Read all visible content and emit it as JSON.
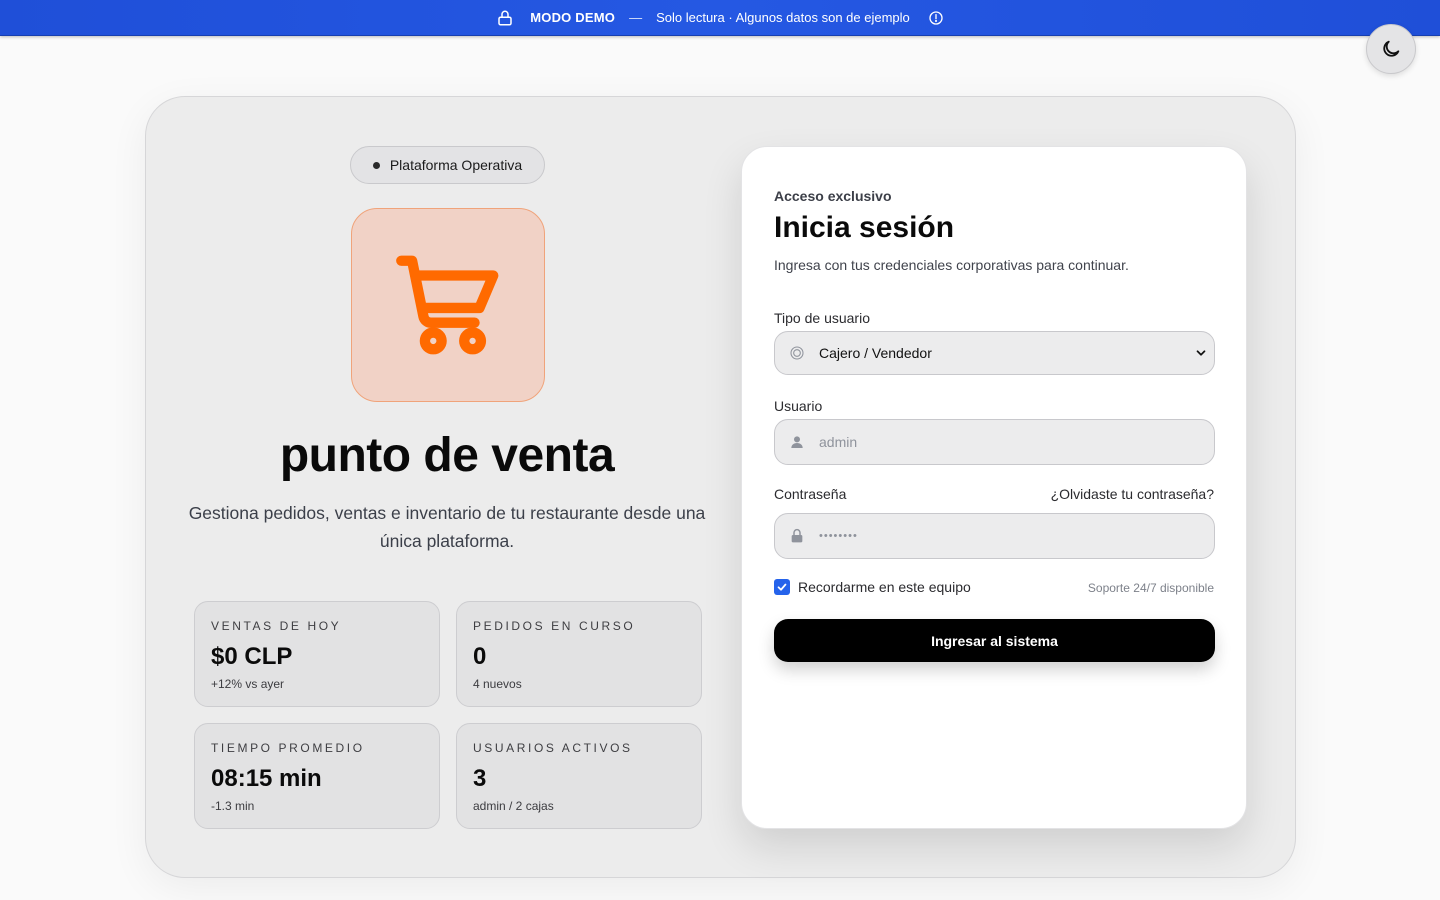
{
  "banner": {
    "mode": "MODO DEMO",
    "separator": "—",
    "message": "Solo lectura · Algunos datos son de ejemplo",
    "lock_icon": "lock-icon",
    "info_icon": "info-icon"
  },
  "theme_toggle": {
    "icon": "moon-icon"
  },
  "brand": {
    "pill": "Plataforma Operativa",
    "icon": "shopping-cart-icon",
    "title": "punto de venta",
    "subtitle": "Gestiona pedidos, ventas e inventario de tu restaurante desde una única plataforma."
  },
  "stats": [
    {
      "label": "Ventas de hoy",
      "value": "$0 CLP",
      "note": "+12% vs ayer"
    },
    {
      "label": "Pedidos en curso",
      "value": "0",
      "note": "4 nuevos"
    },
    {
      "label": "Tiempo promedio",
      "value": "08:15 min",
      "note": "-1.3 min"
    },
    {
      "label": "Usuarios activos",
      "value": "3",
      "note": "admin / 2 cajas"
    }
  ],
  "login": {
    "eyebrow": "Acceso exclusivo",
    "heading": "Inicia sesión",
    "description": "Ingresa con tus credenciales corporativas para continuar.",
    "user_type_label": "Tipo de usuario",
    "user_type_value": "Cajero / Vendedor",
    "username_label": "Usuario",
    "username_placeholder": "admin",
    "password_label": "Contraseña",
    "forgot_link": "¿Olvidaste tu contraseña?",
    "password_value": "••••••••",
    "remember_label": "Recordarme en este equipo",
    "remember_checked": true,
    "support_text": "Soporte 24/7 disponible",
    "submit_label": "Ingresar al sistema"
  },
  "colors": {
    "banner": "#2558e3",
    "accent_orange": "#ff6a00",
    "checkbox": "#2563eb",
    "button": "#000000"
  }
}
